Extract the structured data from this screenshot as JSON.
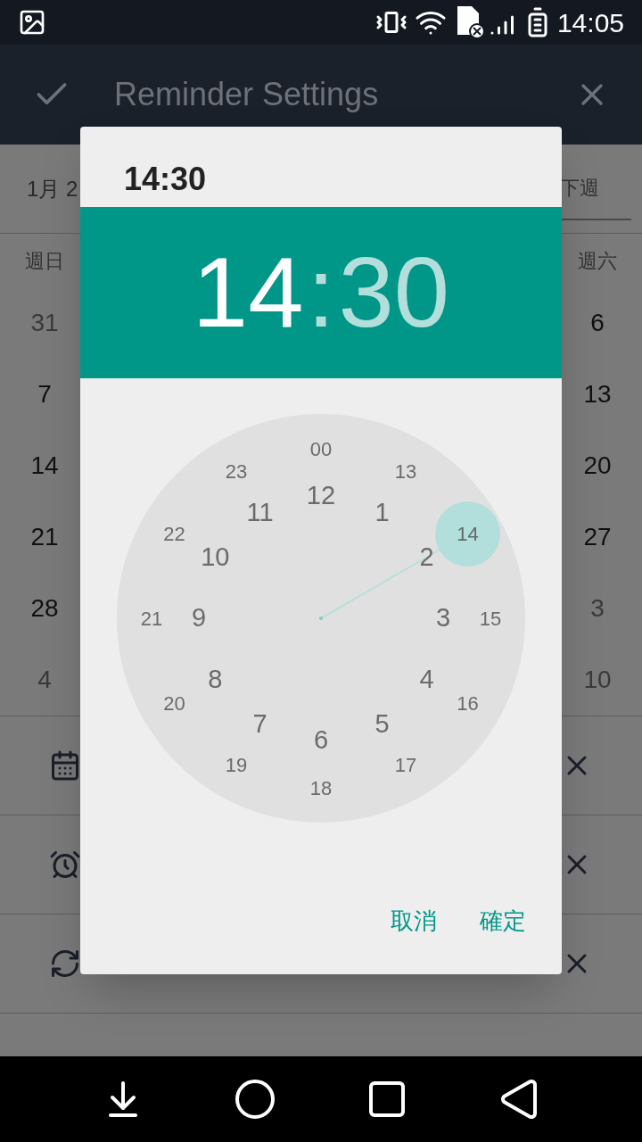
{
  "status_bar": {
    "time": "14:05"
  },
  "app_bar": {
    "title": "Reminder Settings"
  },
  "calendar": {
    "month": "1月 2",
    "next": "下週",
    "columns": [
      {
        "weekday": "週日",
        "days": [
          {
            "label": "31",
            "muted": true
          },
          {
            "label": "7",
            "muted": false
          },
          {
            "label": "14",
            "muted": false
          },
          {
            "label": "21",
            "muted": false
          },
          {
            "label": "28",
            "muted": false
          },
          {
            "label": "4",
            "muted": true
          }
        ]
      },
      {
        "weekday": "週六",
        "days": [
          {
            "label": "6",
            "muted": false
          },
          {
            "label": "13",
            "muted": false
          },
          {
            "label": "20",
            "muted": false
          },
          {
            "label": "27",
            "muted": false
          },
          {
            "label": "3",
            "muted": true
          },
          {
            "label": "10",
            "muted": true
          }
        ]
      }
    ]
  },
  "settings_rows": [
    {
      "kind": "date"
    },
    {
      "kind": "alarm"
    },
    {
      "kind": "repeat"
    }
  ],
  "dialog": {
    "title": "14:30",
    "hour": {
      "label": "14",
      "selected": true
    },
    "separator": ":",
    "minute": {
      "label": "30",
      "selected": false
    },
    "dial": {
      "outer": [
        {
          "label": "00",
          "selected": false
        },
        {
          "label": "13",
          "selected": false
        },
        {
          "label": "14",
          "selected": true
        },
        {
          "label": "15",
          "selected": false
        },
        {
          "label": "16",
          "selected": false
        },
        {
          "label": "17",
          "selected": false
        },
        {
          "label": "18",
          "selected": false
        },
        {
          "label": "19",
          "selected": false
        },
        {
          "label": "20",
          "selected": false
        },
        {
          "label": "21",
          "selected": false
        },
        {
          "label": "22",
          "selected": false
        },
        {
          "label": "23",
          "selected": false
        }
      ],
      "inner": [
        {
          "label": "12",
          "selected": false
        },
        {
          "label": "1",
          "selected": false
        },
        {
          "label": "2",
          "selected": false
        },
        {
          "label": "3",
          "selected": false
        },
        {
          "label": "4",
          "selected": false
        },
        {
          "label": "5",
          "selected": false
        },
        {
          "label": "6",
          "selected": false
        },
        {
          "label": "7",
          "selected": false
        },
        {
          "label": "8",
          "selected": false
        },
        {
          "label": "9",
          "selected": false
        },
        {
          "label": "10",
          "selected": false
        },
        {
          "label": "11",
          "selected": false
        }
      ]
    },
    "buttons": [
      "取消",
      "確定"
    ]
  }
}
